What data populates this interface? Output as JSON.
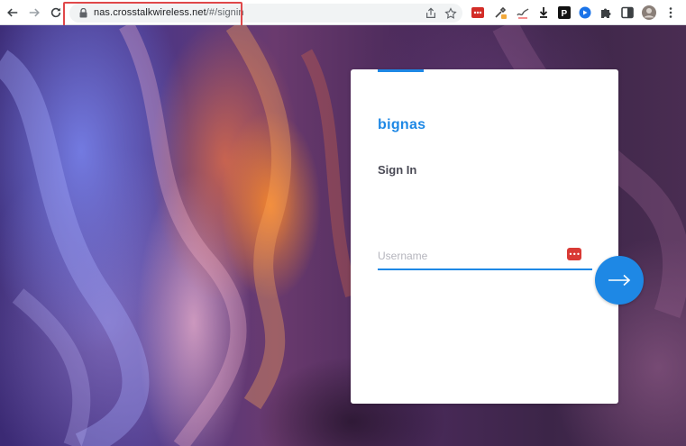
{
  "browser": {
    "url_host": "nas.crosstalkwireless.net",
    "url_path": "/#/signin",
    "extensions": [
      "lastpass-icon",
      "eyedropper-icon",
      "drawing-icon",
      "download-icon",
      "p-icon",
      "media-icon",
      "puzzle-icon",
      "sidepanel-icon"
    ]
  },
  "signin": {
    "brand": "bignas",
    "heading": "Sign In",
    "username_placeholder": "Username",
    "username_value": "",
    "password_manager_dots": "•••"
  },
  "colors": {
    "accent": "#1e88e5",
    "highlight_box": "#e0484a"
  }
}
